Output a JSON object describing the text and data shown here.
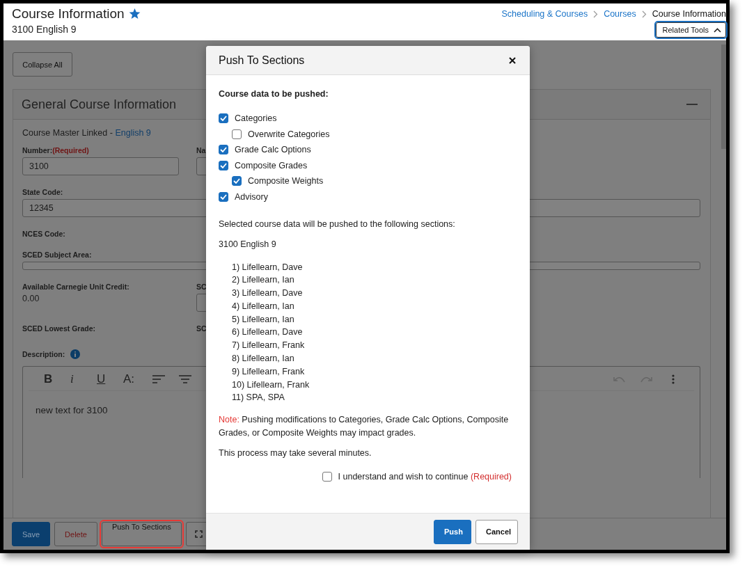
{
  "header": {
    "title": "Course Information",
    "subtitle": "3100 English 9",
    "breadcrumbs": [
      {
        "label": "Scheduling & Courses",
        "kind": "link"
      },
      {
        "label": "Courses",
        "kind": "link"
      },
      {
        "label": "Course Information",
        "kind": "current"
      }
    ],
    "related_tools": {
      "label": "Related Tools",
      "expanded": true
    }
  },
  "collapse_all": "Collapse All",
  "section": {
    "title": "General Course Information",
    "expanded": true,
    "master_text": "Course Master Linked - ",
    "master_link": "English 9",
    "rows": [
      [
        {
          "label": "Number:",
          "required": "(Required)",
          "kind": "input",
          "value": "3100"
        },
        {
          "label": "Na",
          "kind": "input"
        }
      ],
      [
        {
          "label": "State Code:",
          "kind": "input",
          "value": "12345"
        }
      ],
      [
        {
          "label": "NCES Code:",
          "kind": "none"
        }
      ],
      [
        {
          "label": "SCED Subject Area:",
          "kind": "input"
        }
      ],
      [
        {
          "label": "Available Carnegie Unit Credit:",
          "kind": "text",
          "value": "0.00"
        },
        {
          "label": "SC",
          "kind": "input"
        }
      ],
      [
        {
          "label": "SCED Lowest Grade:",
          "kind": "none"
        },
        {
          "label": "SC",
          "kind": "none"
        }
      ]
    ],
    "description_label": "Description:",
    "editor_tools": [
      {
        "glyph": "B",
        "kind": "bold"
      },
      {
        "glyph": "i",
        "kind": "italic"
      },
      {
        "glyph": "U",
        "kind": "underline"
      },
      {
        "glyph": "A:",
        "kind": "size"
      }
    ],
    "description": "new text for 3100"
  },
  "action_bar": [
    {
      "label": "Save",
      "kind": "primary",
      "highlighted": false
    },
    {
      "label": "Delete",
      "kind": "danger",
      "highlighted": false
    },
    {
      "label": "Push To Sections",
      "kind": "default",
      "highlighted": true
    },
    {
      "kind": "fullscreen",
      "highlighted": false
    }
  ],
  "dialog": {
    "title": "Push To Sections",
    "heading": "Course data to be pushed:",
    "options": [
      {
        "label": "Categories",
        "checked": true,
        "children": [
          {
            "label": "Overwrite Categories",
            "checked": false
          }
        ]
      },
      {
        "label": "Grade Calc Options",
        "checked": true
      },
      {
        "label": "Composite Grades",
        "checked": true,
        "children": [
          {
            "label": "Composite Weights",
            "checked": true
          }
        ]
      },
      {
        "label": "Advisory",
        "checked": true
      }
    ],
    "intro": "Selected course data will be pushed to the following sections:",
    "course": "3100 English 9",
    "sections": [
      "1) Lifellearn, Dave",
      "2) Lifellearn, Ian",
      "3) Lifellearn, Dave",
      "4) Lifellearn, Ian",
      "5) Lifellearn, Ian",
      "6) Lifellearn, Dave",
      "7) Lifellearn, Frank",
      "8) Lifellearn, Ian",
      "9) Lifellearn, Frank",
      "10) Lifellearn, Frank",
      "11) SPA, SPA"
    ],
    "note_label": "Note:",
    "note": "Pushing modifications to Categories, Grade Calc Options, Composite Grades, or Composite Weights may impact grades.",
    "process": "This process may take several minutes.",
    "confirm": {
      "label": "I understand and wish to continue",
      "required": "(Required)",
      "checked": false
    },
    "buttons": [
      {
        "label": "Push",
        "kind": "primary"
      },
      {
        "label": "Cancel",
        "kind": "secondary"
      }
    ]
  }
}
